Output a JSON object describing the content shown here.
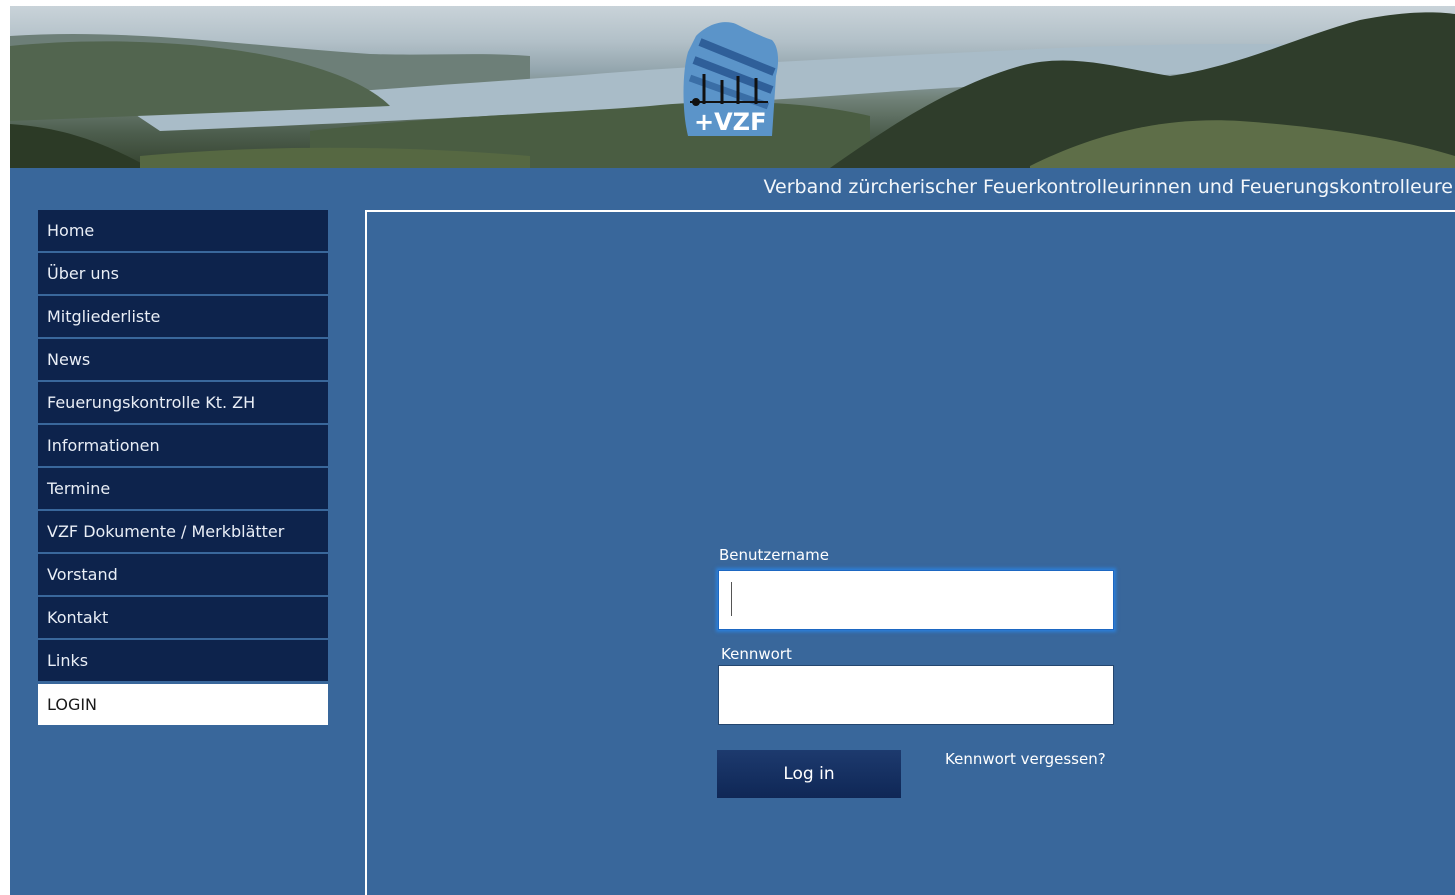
{
  "header": {
    "logo_text": "+VZF",
    "tagline": "Verband zürcherischer Feuerkontrolleurinnen und Feuerungskontrolleure"
  },
  "sidebar": {
    "items": [
      {
        "label": "Home"
      },
      {
        "label": "Über uns"
      },
      {
        "label": "Mitgliederliste"
      },
      {
        "label": "News"
      },
      {
        "label": "Feuerungskontrolle Kt. ZH"
      },
      {
        "label": "Informationen"
      },
      {
        "label": "Termine"
      },
      {
        "label": "VZF Dokumente / Merkblätter"
      },
      {
        "label": "Vorstand"
      },
      {
        "label": "Kontakt"
      },
      {
        "label": "Links"
      },
      {
        "label": "LOGIN",
        "active": true
      }
    ]
  },
  "login": {
    "username_label": "Benutzername",
    "username_value": "",
    "password_label": "Kennwort",
    "password_value": "",
    "submit_label": "Log in",
    "forgot_label": "Kennwort vergessen?"
  },
  "colors": {
    "page_background": "#39679b",
    "nav_background": "#0d234c",
    "nav_active_background": "#ffffff",
    "button_background": "#132d5e",
    "focus_ring": "#2c7fd8"
  }
}
